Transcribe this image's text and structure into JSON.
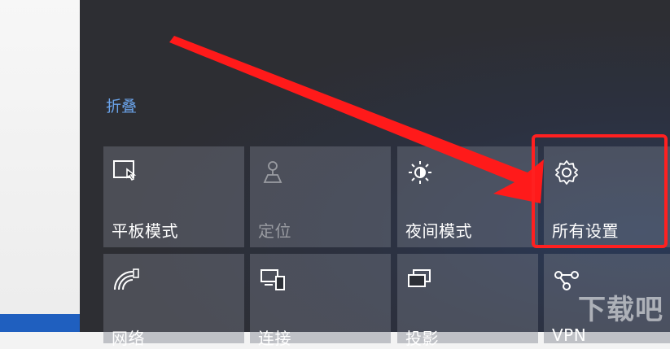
{
  "action_center": {
    "collapse_label": "折叠",
    "tiles": [
      {
        "label": "平板模式",
        "icon": "tablet-mode-icon",
        "state": "off"
      },
      {
        "label": "定位",
        "icon": "location-icon",
        "state": "disabled"
      },
      {
        "label": "夜间模式",
        "icon": "night-light-icon",
        "state": "off"
      },
      {
        "label": "所有设置",
        "icon": "settings-gear-icon",
        "state": "off"
      },
      {
        "label": "网络",
        "icon": "network-icon",
        "state": "off"
      },
      {
        "label": "连接",
        "icon": "connect-icon",
        "state": "off"
      },
      {
        "label": "投影",
        "icon": "project-icon",
        "state": "off"
      },
      {
        "label": "VPN",
        "icon": "vpn-icon",
        "state": "off"
      }
    ]
  },
  "annotation": {
    "color": "#ff2020"
  },
  "watermark": {
    "text": "下载吧"
  }
}
